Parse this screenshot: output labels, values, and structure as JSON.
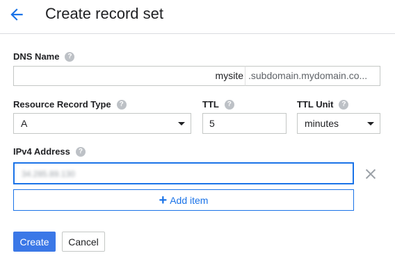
{
  "header": {
    "back_icon": "arrow-left-icon",
    "title": "Create record set"
  },
  "form": {
    "dns_name": {
      "label": "DNS Name",
      "value": "mysite",
      "suffix": ".subdomain.mydomain.co..."
    },
    "record_type": {
      "label": "Resource Record Type",
      "selected": "A"
    },
    "ttl": {
      "label": "TTL",
      "value": "5"
    },
    "ttl_unit": {
      "label": "TTL Unit",
      "selected": "minutes"
    },
    "ipv4": {
      "label": "IPv4 Address",
      "value": "34.285.89.130"
    },
    "add_item_label": "Add item",
    "help_icon_glyph": "?"
  },
  "actions": {
    "create_label": "Create",
    "cancel_label": "Cancel"
  },
  "colors": {
    "accent": "#1a73e8",
    "primary_button": "#3b78e7"
  }
}
